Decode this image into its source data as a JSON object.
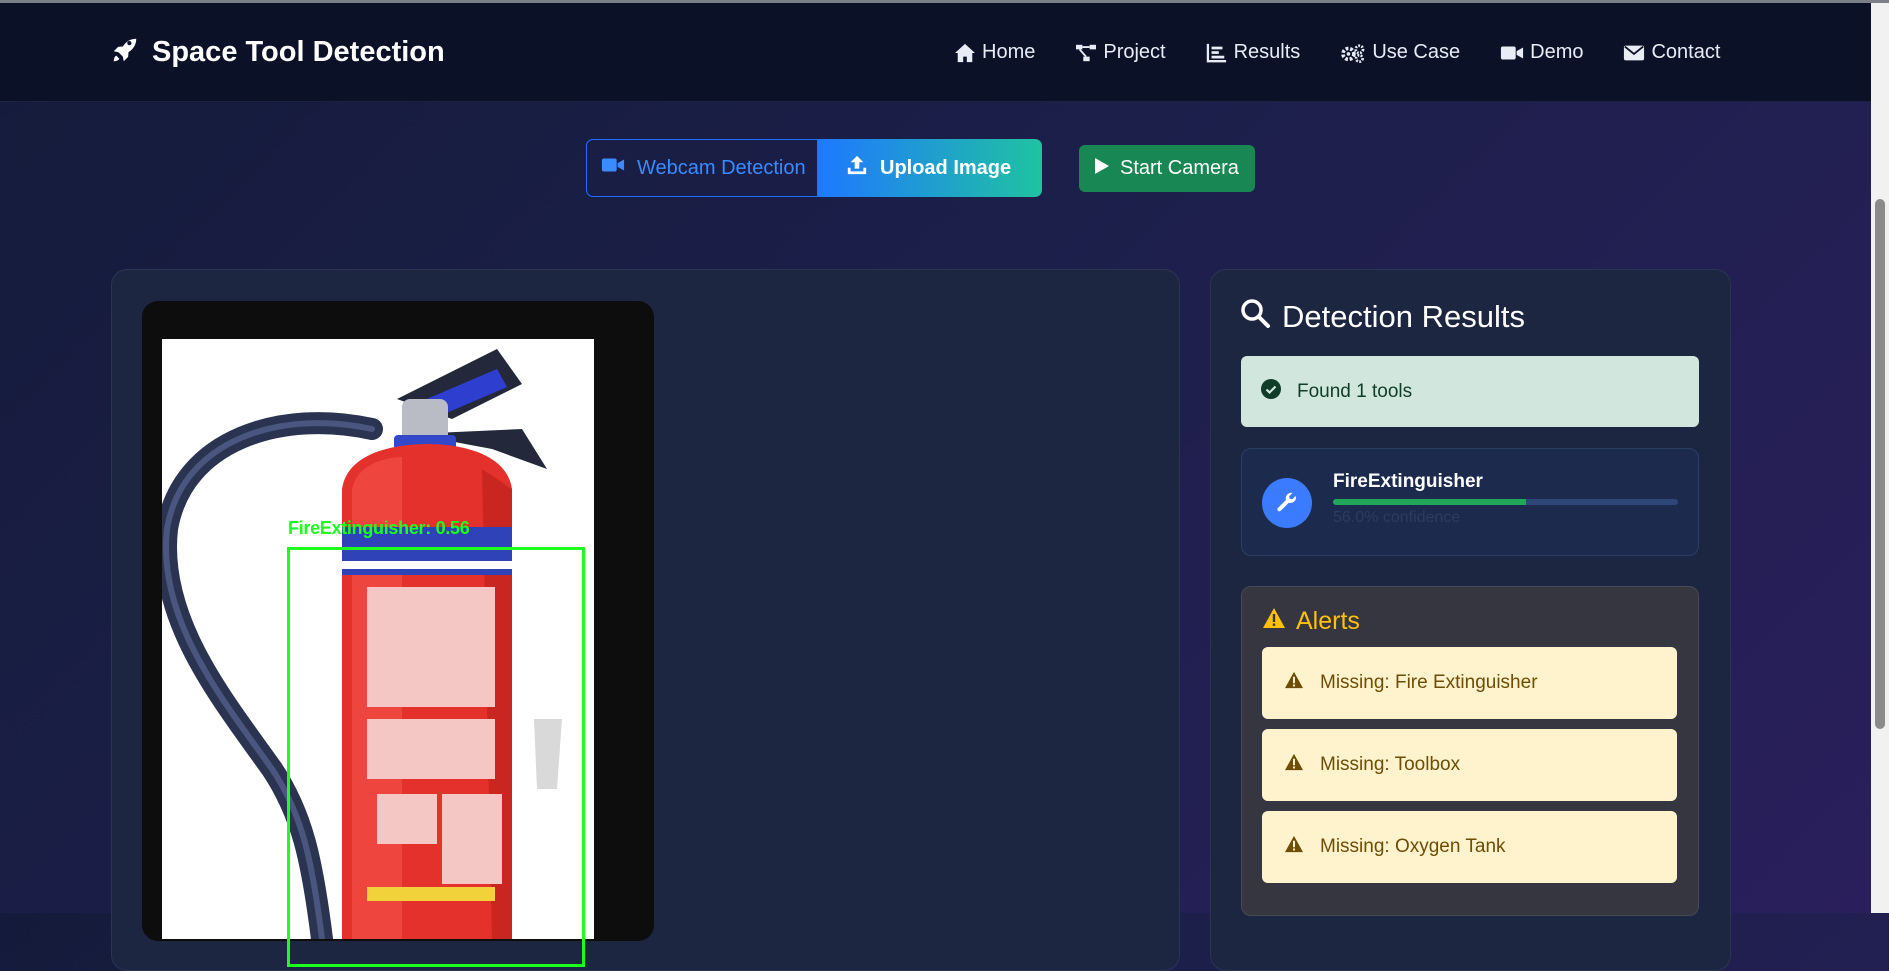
{
  "brand": {
    "title": "Space Tool Detection",
    "icon": "rocket-icon"
  },
  "nav": [
    {
      "label": "Home",
      "icon": "home-icon"
    },
    {
      "label": "Project",
      "icon": "project-diagram-icon"
    },
    {
      "label": "Results",
      "icon": "chart-icon"
    },
    {
      "label": "Use Case",
      "icon": "gears-icon"
    },
    {
      "label": "Demo",
      "icon": "video-icon"
    },
    {
      "label": "Contact",
      "icon": "envelope-icon"
    }
  ],
  "modes": {
    "webcam_label": "Webcam Detection",
    "upload_label": "Upload Image",
    "active": "Upload Image"
  },
  "start_camera_label": "Start Camera",
  "detection_overlay": {
    "label": "FireExtinguisher: 0.56"
  },
  "results": {
    "title": "Detection Results",
    "found_text": "Found 1 tools",
    "tools": [
      {
        "name": "FireExtinguisher",
        "confidence_text": "56.0% confidence",
        "confidence": 0.56
      }
    ]
  },
  "alerts": {
    "title": "Alerts",
    "items": [
      {
        "text": "Missing: Fire Extinguisher"
      },
      {
        "text": "Missing: Toolbox"
      },
      {
        "text": "Missing: Oxygen Tank"
      }
    ]
  },
  "colors": {
    "accent_blue": "#1f6fff",
    "success_green": "#198754",
    "detection_green": "#1dff1d",
    "warning_yellow": "#ffc107"
  }
}
